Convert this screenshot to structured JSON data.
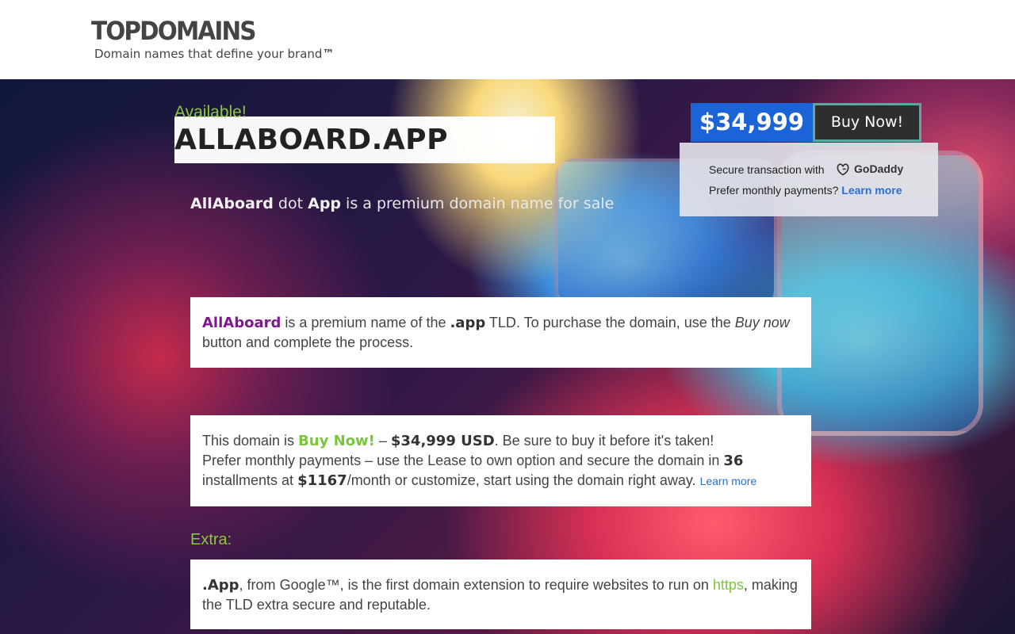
{
  "header": {
    "logo": "TOPDOMAINS",
    "tagline": "Domain names that define your brand",
    "tagline_tm": "™"
  },
  "hero": {
    "available_label": "Available!",
    "domain_name": "ALLABOARD.APP",
    "subtitle_name": "AllAboard",
    "subtitle_dot": " dot ",
    "subtitle_tld": "App",
    "subtitle_rest": " is a premium domain name for sale"
  },
  "purchase": {
    "price": "$34,999",
    "buy_label": "Buy Now!",
    "secure_text": "Secure transaction with",
    "godaddy_label": "GoDaddy",
    "monthly_text": "Prefer monthly payments?",
    "learn_more": "Learn more"
  },
  "card1": {
    "name": "AllAboard",
    "t1": " is a premium name of the ",
    "tld": ".app",
    "t2": " TLD. To purchase the domain, use the ",
    "buy_italic": "Buy now",
    "t3": "button and complete the process."
  },
  "card2": {
    "t1": "This domain is ",
    "buy_now": "Buy Now!",
    "t2": " – ",
    "price": "$34,999 USD",
    "t3": ". Be sure to buy it before it's taken!",
    "line2a": "Prefer monthly payments – use the Lease to own option and secure the domain in ",
    "months": "36",
    "line3a": "installments at ",
    "monthly": "$1167",
    "line3b": "/month or customize, start using the domain right away. ",
    "learn_more": "Learn more"
  },
  "extra": {
    "label": "Extra:",
    "tld": ".App",
    "t1": ", from ",
    "google": "Google™",
    "t2": ", is the first domain extension to require websites to run on ",
    "https": "https",
    "t3": ", making",
    "line2": "the TLD extra secure and reputable."
  },
  "colors": {
    "accent_green": "#8dc63f",
    "price_blue": "#1a64d8",
    "purple": "#7d1a8c",
    "link_blue": "#2a6fd6"
  }
}
